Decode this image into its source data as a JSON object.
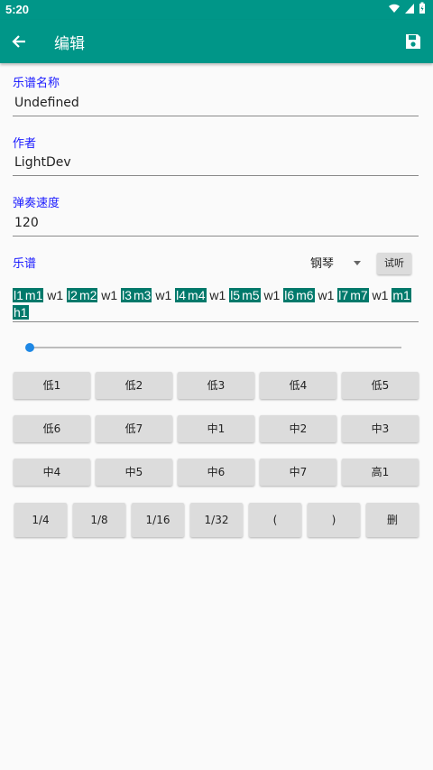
{
  "status": {
    "time": "5:20"
  },
  "appbar": {
    "title": "编辑"
  },
  "form": {
    "name_label": "乐谱名称",
    "name_value": "Undefined",
    "author_label": "作者",
    "author_value": "LightDev",
    "speed_label": "弹奏速度",
    "speed_value": "120",
    "score_label": "乐谱",
    "instrument": "钢琴",
    "try_label": "试听"
  },
  "score_tokens": [
    {
      "t": "l1",
      "hl": true
    },
    {
      "t": "m1",
      "hl": true
    },
    {
      "t": "w1",
      "hl": false
    },
    {
      "t": "l2",
      "hl": true
    },
    {
      "t": "m2",
      "hl": true
    },
    {
      "t": "w1",
      "hl": false
    },
    {
      "t": "l3",
      "hl": true
    },
    {
      "t": "m3",
      "hl": true
    },
    {
      "t": "w1",
      "hl": false
    },
    {
      "t": "l4",
      "hl": true
    },
    {
      "t": "m4",
      "hl": true
    },
    {
      "t": "w1",
      "hl": false
    },
    {
      "t": "l5",
      "hl": true
    },
    {
      "t": "m5",
      "hl": true
    },
    {
      "t": "w1",
      "hl": false
    },
    {
      "t": "l6",
      "hl": true
    },
    {
      "t": "m6",
      "hl": true
    },
    {
      "t": "w1",
      "hl": false
    },
    {
      "t": "l7",
      "hl": true
    },
    {
      "t": "m7",
      "hl": true
    },
    {
      "t": "w1",
      "hl": false
    },
    {
      "t": "m1",
      "hl": true
    },
    {
      "t": "h1",
      "hl": true
    }
  ],
  "slider": {
    "value": 0
  },
  "note_rows": [
    [
      "低1",
      "低2",
      "低3",
      "低4",
      "低5"
    ],
    [
      "低6",
      "低7",
      "中1",
      "中2",
      "中3"
    ],
    [
      "中4",
      "中5",
      "中6",
      "中7",
      "高1"
    ]
  ],
  "control_row": [
    "1/4",
    "1/8",
    "1/16",
    "1/32",
    "(",
    ")",
    "删"
  ],
  "colors": {
    "primary": "#009688",
    "highlight": "#00796b",
    "label": "#1a1aff",
    "accent": "#1e88e5"
  }
}
